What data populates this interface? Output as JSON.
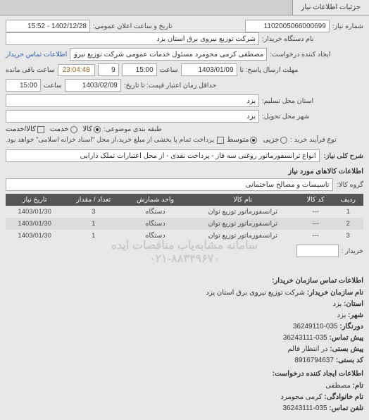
{
  "tabs": {
    "main": "جزئیات اطلاعات نیاز"
  },
  "form": {
    "req_no_label": "شماره نیاز:",
    "req_no": "1102005066000699",
    "pub_date_label": "تاریخ و ساعت اعلان عمومی:",
    "pub_date": "1402/12/28 - 15:52",
    "buyer_label": "نام دستگاه خریدار:",
    "buyer": "شرکت توزیع نیروی برق استان یزد",
    "requester_label": "ایجاد کننده درخواست:",
    "requester": "مصطفی کرمی مجومرد مسئول خدمات عمومی شرکت توزیع نیروی برق استان یـ",
    "contact_link": "اطلاعات تماس خریدار",
    "deadline_label": "مهلت ارسال پاسخ: تا",
    "deadline_date": "1403/01/09",
    "time_label": "ساعت",
    "deadline_time": "15:00",
    "days_remain": "9",
    "time_remain": "23:04:48",
    "remain_label": "ساعت باقی مانده",
    "validity_label": "حداقل زمان اعتبار قیمت: تا تاریخ:",
    "validity_date": "1403/02/09",
    "validity_time": "15:00",
    "location_label": "استان محل تسلیم:",
    "location": "یزد",
    "city_label": "شهر محل تحویل:",
    "city": "یزد",
    "item_group_label": "طبقه بندی موضوعی:",
    "radio_goods": "کالا",
    "radio_service": "خدمت",
    "radio_both": "کالا/خدمت",
    "process_label": "نوع فرآیند خرید :",
    "radio_partial": "جزیی",
    "radio_medium": "متوسط",
    "process_note": "پرداخت تمام یا بخشی از مبلغ خرید،از محل \"اسناد خزانه اسلامی\" خواهد بود.",
    "desc_label": "شرح کلی نیاز:",
    "desc": "انواع ترانسفورماتور روغنی سه فاز - پرداخت نقدی - از محل اعتبارات تملک دارایی",
    "goods_title": "اطلاعات کالاهای مورد نیاز",
    "goods_group_label": "گروه کالا:",
    "goods_group": "تاسیسات و مصالح ساختمانی",
    "buyer2_label": "خریدار :"
  },
  "table": {
    "headers": {
      "row": "ردیف",
      "code": "کد کالا",
      "name": "نام کالا",
      "unit": "واحد شمارش",
      "qty": "تعداد / مقدار",
      "date": "تاریخ نیاز"
    },
    "rows": [
      {
        "row": "1",
        "code": "---",
        "name": "ترانسفورماتور توزیع توان",
        "unit": "دستگاه",
        "qty": "3",
        "date": "1403/01/30"
      },
      {
        "row": "2",
        "code": "---",
        "name": "ترانسفورماتور توزیع توان",
        "unit": "دستگاه",
        "qty": "1",
        "date": "1403/01/30"
      },
      {
        "row": "3",
        "code": "---",
        "name": "ترانسفورماتور توزیع توان",
        "unit": "دستگاه",
        "qty": "1",
        "date": "1403/01/30"
      }
    ]
  },
  "watermark": {
    "line1": "سامانه مشابه‌یاب مناقصات ایده",
    "line2": "۰۲۱-۸۸۳۴۹۶۷۰"
  },
  "info": {
    "title": "اطلاعات تماس سازمان خریدار:",
    "org_label": "نام سازمان خریدار:",
    "org": "شرکت توزیع نیروی برق استان یزد",
    "province_label": "استان:",
    "province": "یزد",
    "city_label": "شهر:",
    "city": "یزد",
    "fax_label": "دورنگار:",
    "fax": "035-36249110",
    "pre_label": "پیش تماس:",
    "pre": "035-36243111",
    "post_label": "پیش بستی:",
    "post": "در انتظار فالم",
    "postcode_label": "کد بستی:",
    "postcode": "8916794637",
    "creator_title": "اطلاعات ایجاد کننده درخواست:",
    "fname_label": "نام:",
    "fname": "مصطفی",
    "lname_label": "نام خانوادگی:",
    "lname": "کرمی مجومرد",
    "tel_label": "تلفن تماس:",
    "tel": "035-36243111"
  }
}
